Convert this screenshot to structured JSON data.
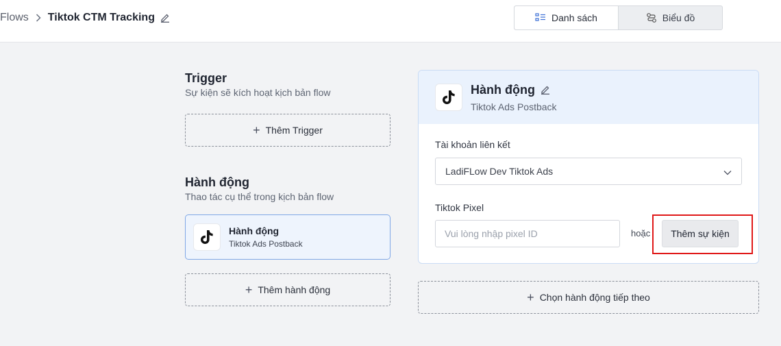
{
  "breadcrumb": {
    "root": "Flows",
    "current": "Tiktok CTM Tracking"
  },
  "view_toggle": {
    "list_label": "Danh sách",
    "chart_label": "Biểu đồ"
  },
  "trigger_section": {
    "title": "Trigger",
    "subtitle": "Sự kiện sẽ kích hoạt kịch bản flow",
    "add_label": "Thêm Trigger"
  },
  "action_section": {
    "title": "Hành động",
    "subtitle": "Thao tác cụ thể trong kịch bản flow",
    "card_title": "Hành động",
    "card_subtitle": "Tiktok Ads Postback",
    "add_label": "Thêm hành động"
  },
  "panel": {
    "title": "Hành động",
    "subtitle": "Tiktok Ads Postback",
    "account_label": "Tài khoản liên kết",
    "account_value": "LadiFLow Dev Tiktok Ads",
    "pixel_label": "Tiktok Pixel",
    "pixel_placeholder": "Vui lòng nhập pixel ID",
    "pixel_value": "",
    "or_text": "hoặc",
    "add_event_label": "Thêm sự kiện"
  },
  "next_action": {
    "label": "Chọn hành động tiếp theo"
  },
  "icons": {
    "breadcrumb_sep": "chevron-right-icon",
    "edit": "pencil-icon",
    "list": "list-icon",
    "chart": "flow-chart-icon",
    "tiktok": "tiktok-icon",
    "select": "chevron-down-icon",
    "add": "plus-icon"
  },
  "colors": {
    "accent": "#7fa7e6",
    "highlight": "#e01818",
    "panel_header": "#eaf2fd"
  }
}
